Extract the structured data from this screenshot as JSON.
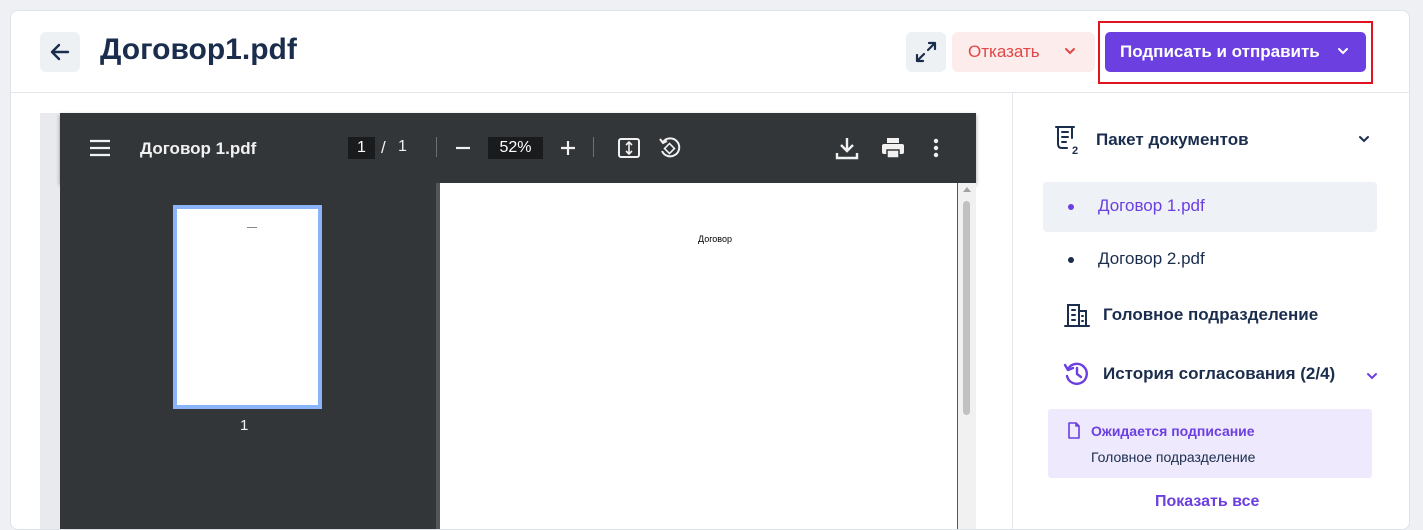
{
  "header": {
    "back_icon": "arrow-left-icon",
    "title": "Договор1.pdf",
    "expand_icon": "expand-arrows-icon",
    "reject_label": "Отказать",
    "sign_label": "Подписать и отправить"
  },
  "viewer": {
    "doc_name": "Договор 1.pdf",
    "page_current": "1",
    "page_separator": "/",
    "page_total": "1",
    "zoom": "52%",
    "thumbnail_number": "1",
    "page_text": "Договор"
  },
  "sidebar": {
    "package_label": "Пакет документов",
    "documents": [
      {
        "label": "Договор 1.pdf",
        "active": true
      },
      {
        "label": "Договор 2.pdf",
        "active": false
      }
    ],
    "org_label": "Головное подразделение",
    "history_label": "История согласования (2/4)",
    "history_status": "Ожидается подписание",
    "history_org": "Головное подразделение",
    "show_all": "Показать все"
  },
  "colors": {
    "accent": "#6b3fe0",
    "danger": "#e24646",
    "title": "#1b2d4d",
    "highlight_outline": "#e0141e"
  }
}
